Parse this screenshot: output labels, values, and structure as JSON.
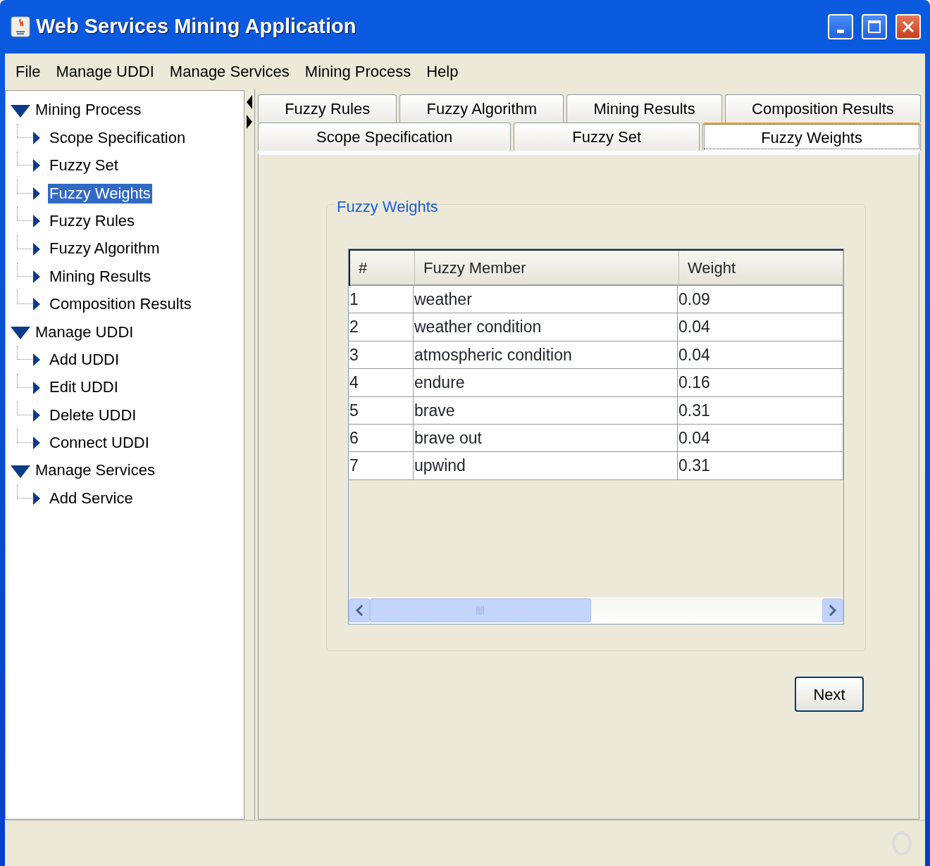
{
  "window": {
    "title": "Web Services Mining Application"
  },
  "menu": [
    {
      "label": "File"
    },
    {
      "label": "Manage UDDI"
    },
    {
      "label": "Manage Services"
    },
    {
      "label": "Mining Process"
    },
    {
      "label": "Help"
    }
  ],
  "tree": [
    {
      "label": "Mining Process",
      "expanded": true,
      "selected": false,
      "children": [
        {
          "label": "Scope Specification",
          "expanded": false,
          "selected": false
        },
        {
          "label": "Fuzzy Set",
          "expanded": false,
          "selected": false
        },
        {
          "label": "Fuzzy Weights",
          "expanded": false,
          "selected": true
        },
        {
          "label": "Fuzzy Rules",
          "expanded": false,
          "selected": false
        },
        {
          "label": "Fuzzy Algorithm",
          "expanded": false,
          "selected": false
        },
        {
          "label": "Mining Results",
          "expanded": false,
          "selected": false
        },
        {
          "label": "Composition Results",
          "expanded": false,
          "selected": false
        }
      ]
    },
    {
      "label": "Manage UDDI",
      "expanded": true,
      "selected": false,
      "children": [
        {
          "label": "Add UDDI",
          "expanded": false,
          "selected": false
        },
        {
          "label": "Edit UDDI",
          "expanded": false,
          "selected": false
        },
        {
          "label": "Delete UDDI",
          "expanded": false,
          "selected": false
        },
        {
          "label": "Connect UDDI",
          "expanded": false,
          "selected": false
        }
      ]
    },
    {
      "label": "Manage Services",
      "expanded": true,
      "selected": false,
      "children": [
        {
          "label": "Add Service",
          "expanded": false,
          "selected": false
        }
      ]
    }
  ],
  "tab_rows": [
    {
      "tabs": [
        {
          "label": "Fuzzy Rules",
          "selected": false
        },
        {
          "label": "Fuzzy Algorithm",
          "selected": false
        },
        {
          "label": "Mining Results",
          "selected": false
        },
        {
          "label": "Composition Results",
          "selected": false
        }
      ]
    },
    {
      "tabs": [
        {
          "label": "Scope Specification",
          "selected": false
        },
        {
          "label": "Fuzzy Set",
          "selected": false
        },
        {
          "label": "Fuzzy Weights",
          "selected": true
        }
      ]
    }
  ],
  "panel": {
    "legend": "Fuzzy Weights",
    "table": {
      "columns": [
        "#",
        "Fuzzy Member",
        "Weight"
      ],
      "rows": [
        [
          "1",
          "weather",
          "0.09"
        ],
        [
          "2",
          "weather condition",
          "0.04"
        ],
        [
          "3",
          "atmospheric condition",
          "0.04"
        ],
        [
          "4",
          "endure",
          "0.16"
        ],
        [
          "5",
          "brave",
          "0.31"
        ],
        [
          "6",
          "brave out",
          "0.04"
        ],
        [
          "7",
          "upwind",
          "0.31"
        ]
      ]
    }
  },
  "next_button": "Next"
}
